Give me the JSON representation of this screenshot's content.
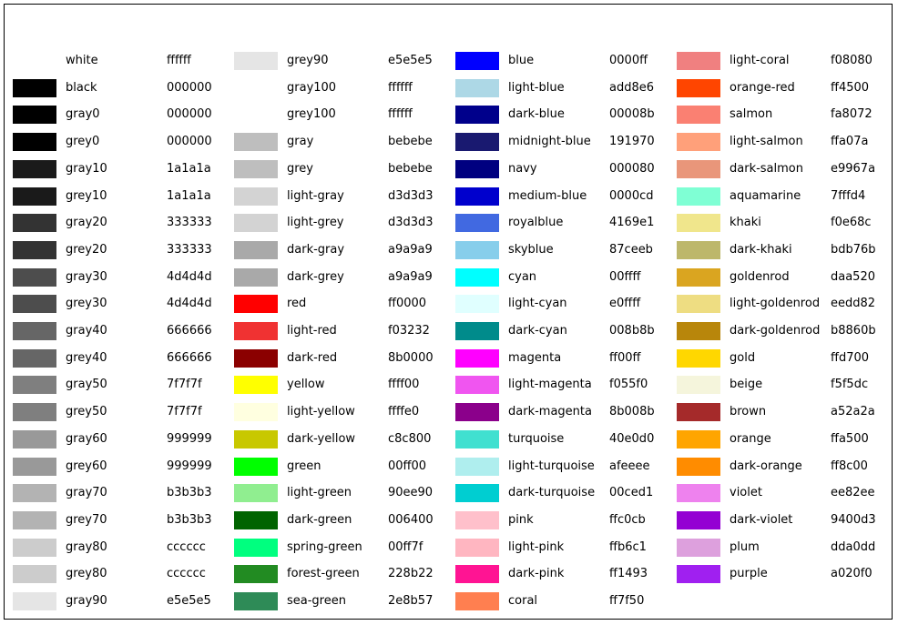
{
  "chart_data": {
    "type": "table",
    "title": "",
    "columns": [
      [
        {
          "name": "white",
          "hex": "ffffff",
          "color": "#ffffff"
        },
        {
          "name": "black",
          "hex": "000000",
          "color": "#000000"
        },
        {
          "name": "gray0",
          "hex": "000000",
          "color": "#000000"
        },
        {
          "name": "grey0",
          "hex": "000000",
          "color": "#000000"
        },
        {
          "name": "gray10",
          "hex": "1a1a1a",
          "color": "#1a1a1a"
        },
        {
          "name": "grey10",
          "hex": "1a1a1a",
          "color": "#1a1a1a"
        },
        {
          "name": "gray20",
          "hex": "333333",
          "color": "#333333"
        },
        {
          "name": "grey20",
          "hex": "333333",
          "color": "#333333"
        },
        {
          "name": "gray30",
          "hex": "4d4d4d",
          "color": "#4d4d4d"
        },
        {
          "name": "grey30",
          "hex": "4d4d4d",
          "color": "#4d4d4d"
        },
        {
          "name": "gray40",
          "hex": "666666",
          "color": "#666666"
        },
        {
          "name": "grey40",
          "hex": "666666",
          "color": "#666666"
        },
        {
          "name": "gray50",
          "hex": "7f7f7f",
          "color": "#7f7f7f"
        },
        {
          "name": "grey50",
          "hex": "7f7f7f",
          "color": "#7f7f7f"
        },
        {
          "name": "gray60",
          "hex": "999999",
          "color": "#999999"
        },
        {
          "name": "grey60",
          "hex": "999999",
          "color": "#999999"
        },
        {
          "name": "gray70",
          "hex": "b3b3b3",
          "color": "#b3b3b3"
        },
        {
          "name": "grey70",
          "hex": "b3b3b3",
          "color": "#b3b3b3"
        },
        {
          "name": "gray80",
          "hex": "cccccc",
          "color": "#cccccc"
        },
        {
          "name": "grey80",
          "hex": "cccccc",
          "color": "#cccccc"
        },
        {
          "name": "gray90",
          "hex": "e5e5e5",
          "color": "#e5e5e5"
        }
      ],
      [
        {
          "name": "grey90",
          "hex": "e5e5e5",
          "color": "#e5e5e5"
        },
        {
          "name": "gray100",
          "hex": "ffffff",
          "color": "#ffffff"
        },
        {
          "name": "grey100",
          "hex": "ffffff",
          "color": "#ffffff"
        },
        {
          "name": "gray",
          "hex": "bebebe",
          "color": "#bebebe"
        },
        {
          "name": "grey",
          "hex": "bebebe",
          "color": "#bebebe"
        },
        {
          "name": "light-gray",
          "hex": "d3d3d3",
          "color": "#d3d3d3"
        },
        {
          "name": "light-grey",
          "hex": "d3d3d3",
          "color": "#d3d3d3"
        },
        {
          "name": "dark-gray",
          "hex": "a9a9a9",
          "color": "#a9a9a9"
        },
        {
          "name": "dark-grey",
          "hex": "a9a9a9",
          "color": "#a9a9a9"
        },
        {
          "name": "red",
          "hex": "ff0000",
          "color": "#ff0000"
        },
        {
          "name": "light-red",
          "hex": "f03232",
          "color": "#f03232"
        },
        {
          "name": "dark-red",
          "hex": "8b0000",
          "color": "#8b0000"
        },
        {
          "name": "yellow",
          "hex": "ffff00",
          "color": "#ffff00"
        },
        {
          "name": "light-yellow",
          "hex": "ffffe0",
          "color": "#ffffe0"
        },
        {
          "name": "dark-yellow",
          "hex": "c8c800",
          "color": "#c8c800"
        },
        {
          "name": "green",
          "hex": "00ff00",
          "color": "#00ff00"
        },
        {
          "name": "light-green",
          "hex": "90ee90",
          "color": "#90ee90"
        },
        {
          "name": "dark-green",
          "hex": "006400",
          "color": "#006400"
        },
        {
          "name": "spring-green",
          "hex": "00ff7f",
          "color": "#00ff7f"
        },
        {
          "name": "forest-green",
          "hex": "228b22",
          "color": "#228b22"
        },
        {
          "name": "sea-green",
          "hex": "2e8b57",
          "color": "#2e8b57"
        }
      ],
      [
        {
          "name": "blue",
          "hex": "0000ff",
          "color": "#0000ff"
        },
        {
          "name": "light-blue",
          "hex": "add8e6",
          "color": "#add8e6"
        },
        {
          "name": "dark-blue",
          "hex": "00008b",
          "color": "#00008b"
        },
        {
          "name": "midnight-blue",
          "hex": "191970",
          "color": "#191970"
        },
        {
          "name": "navy",
          "hex": "000080",
          "color": "#000080"
        },
        {
          "name": "medium-blue",
          "hex": "0000cd",
          "color": "#0000cd"
        },
        {
          "name": "royalblue",
          "hex": "4169e1",
          "color": "#4169e1"
        },
        {
          "name": "skyblue",
          "hex": "87ceeb",
          "color": "#87ceeb"
        },
        {
          "name": "cyan",
          "hex": "00ffff",
          "color": "#00ffff"
        },
        {
          "name": "light-cyan",
          "hex": "e0ffff",
          "color": "#e0ffff"
        },
        {
          "name": "dark-cyan",
          "hex": "008b8b",
          "color": "#008b8b"
        },
        {
          "name": "magenta",
          "hex": "ff00ff",
          "color": "#ff00ff"
        },
        {
          "name": "light-magenta",
          "hex": "f055f0",
          "color": "#f055f0"
        },
        {
          "name": "dark-magenta",
          "hex": "8b008b",
          "color": "#8b008b"
        },
        {
          "name": "turquoise",
          "hex": "40e0d0",
          "color": "#40e0d0"
        },
        {
          "name": "light-turquoise",
          "hex": "afeeee",
          "color": "#afeeee"
        },
        {
          "name": "dark-turquoise",
          "hex": "00ced1",
          "color": "#00ced1"
        },
        {
          "name": "pink",
          "hex": "ffc0cb",
          "color": "#ffc0cb"
        },
        {
          "name": "light-pink",
          "hex": "ffb6c1",
          "color": "#ffb6c1"
        },
        {
          "name": "dark-pink",
          "hex": "ff1493",
          "color": "#ff1493"
        },
        {
          "name": "coral",
          "hex": "ff7f50",
          "color": "#ff7f50"
        }
      ],
      [
        {
          "name": "light-coral",
          "hex": "f08080",
          "color": "#f08080"
        },
        {
          "name": "orange-red",
          "hex": "ff4500",
          "color": "#ff4500"
        },
        {
          "name": "salmon",
          "hex": "fa8072",
          "color": "#fa8072"
        },
        {
          "name": "light-salmon",
          "hex": "ffa07a",
          "color": "#ffa07a"
        },
        {
          "name": "dark-salmon",
          "hex": "e9967a",
          "color": "#e9967a"
        },
        {
          "name": "aquamarine",
          "hex": "7fffd4",
          "color": "#7fffd4"
        },
        {
          "name": "khaki",
          "hex": "f0e68c",
          "color": "#f0e68c"
        },
        {
          "name": "dark-khaki",
          "hex": "bdb76b",
          "color": "#bdb76b"
        },
        {
          "name": "goldenrod",
          "hex": "daa520",
          "color": "#daa520"
        },
        {
          "name": "light-goldenrod",
          "hex": "eedd82",
          "color": "#eedd82"
        },
        {
          "name": "dark-goldenrod",
          "hex": "b8860b",
          "color": "#b8860b"
        },
        {
          "name": "gold",
          "hex": "ffd700",
          "color": "#ffd700"
        },
        {
          "name": "beige",
          "hex": "f5f5dc",
          "color": "#f5f5dc"
        },
        {
          "name": "brown",
          "hex": "a52a2a",
          "color": "#a52a2a"
        },
        {
          "name": "orange",
          "hex": "ffa500",
          "color": "#ffa500"
        },
        {
          "name": "dark-orange",
          "hex": "ff8c00",
          "color": "#ff8c00"
        },
        {
          "name": "violet",
          "hex": "ee82ee",
          "color": "#ee82ee"
        },
        {
          "name": "dark-violet",
          "hex": "9400d3",
          "color": "#9400d3"
        },
        {
          "name": "plum",
          "hex": "dda0dd",
          "color": "#dda0dd"
        },
        {
          "name": "purple",
          "hex": "a020f0",
          "color": "#a020f0"
        }
      ]
    ]
  }
}
